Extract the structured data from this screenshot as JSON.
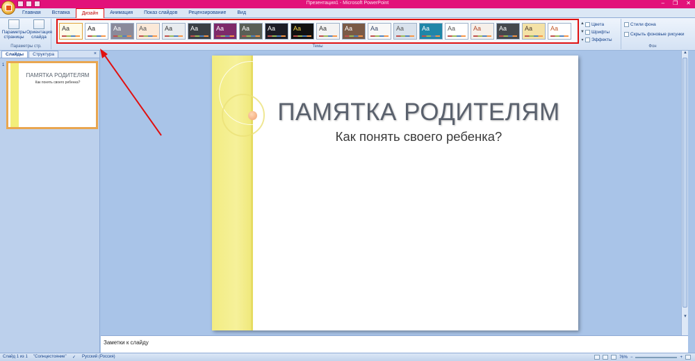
{
  "app": {
    "title": "Презентация1 - Microsoft PowerPoint",
    "window_controls": [
      "–",
      "❐",
      "✕"
    ]
  },
  "tabs": [
    {
      "label": "Главная"
    },
    {
      "label": "Вставка"
    },
    {
      "label": "Дизайн",
      "active": true
    },
    {
      "label": "Анимация"
    },
    {
      "label": "Показ слайдов"
    },
    {
      "label": "Рецензирование"
    },
    {
      "label": "Вид"
    }
  ],
  "ribbon": {
    "page_setup": {
      "label": "Параметры страницы",
      "group_label": "Параметры стр."
    },
    "orientation": {
      "label": "Ориентация слайда"
    },
    "themes_group_label": "Темы",
    "theme_options": [
      {
        "label": "Цвета",
        "icon": "colors-icon"
      },
      {
        "label": "Шрифты",
        "icon": "fonts-icon"
      },
      {
        "label": "Эффекты",
        "icon": "effects-icon"
      }
    ],
    "background": {
      "styles_label": "Стили фона",
      "hide_graphics_label": "Скрыть фоновые рисунки",
      "group_label": "Фон"
    },
    "themes": [
      {
        "bg": "#fffbe8",
        "fg": "#333333",
        "selected": true
      },
      {
        "bg": "#ffffff",
        "fg": "#222222"
      },
      {
        "bg": "#8a8a9a",
        "fg": "#ffffff"
      },
      {
        "bg": "#fbe9d8",
        "fg": "#555555"
      },
      {
        "bg": "#e8ecef",
        "fg": "#333333"
      },
      {
        "bg": "#3a3f44",
        "fg": "#ffffff"
      },
      {
        "bg": "#7d2a6a",
        "fg": "#ffffff"
      },
      {
        "bg": "#5a5f56",
        "fg": "#ffffff"
      },
      {
        "bg": "#1d1d26",
        "fg": "#ffffff"
      },
      {
        "bg": "#111111",
        "fg": "#f6d64a"
      },
      {
        "bg": "#f3f3f3",
        "fg": "#333333"
      },
      {
        "bg": "#7a5a46",
        "fg": "#ffffff"
      },
      {
        "bg": "#f8f8f8",
        "fg": "#3a4a6a"
      },
      {
        "bg": "#d9e2ec",
        "fg": "#555555"
      },
      {
        "bg": "#1f86a8",
        "fg": "#ffffff"
      },
      {
        "bg": "#ffffff",
        "fg": "#555555"
      },
      {
        "bg": "#f6f0ea",
        "fg": "#b24a2a"
      },
      {
        "bg": "#44484c",
        "fg": "#ffffff"
      },
      {
        "bg": "#f4e2a6",
        "fg": "#4a3a2a"
      },
      {
        "bg": "#ffffff",
        "fg": "#c25a2a"
      }
    ],
    "theme_aa": "Aa"
  },
  "left_pane": {
    "tab_slides": "Слайды",
    "tab_outline": "Структура",
    "close": "×",
    "slide_number": "1"
  },
  "slide": {
    "title": "ПАМЯТКА РОДИТЕЛЯМ",
    "subtitle": "Как понять своего ребенка?"
  },
  "notes": {
    "placeholder": "Заметки к слайду"
  },
  "status": {
    "slide_info": "Слайд 1 из 1",
    "theme": "\"Солнцестояние\"",
    "language": "Русский (Россия)",
    "zoom": "76%"
  },
  "colors": {
    "titlebar": "#e2127a",
    "highlight": "#e01010"
  }
}
